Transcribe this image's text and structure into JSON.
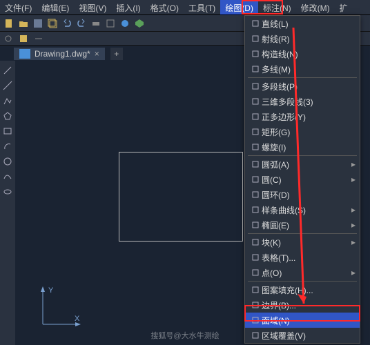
{
  "menubar": {
    "items": [
      "文件(F)",
      "编辑(E)",
      "视图(V)",
      "插入(I)",
      "格式(O)",
      "工具(T)",
      "绘图(D)",
      "标注(N)",
      "修改(M)",
      "扩"
    ],
    "activeIndex": 6
  },
  "tab": {
    "label": "Drawing1.dwg*"
  },
  "dropdown": {
    "items": [
      {
        "icon": "line-icon",
        "label": "直线(L)",
        "sub": false
      },
      {
        "icon": "ray-icon",
        "label": "射线(R)",
        "sub": false
      },
      {
        "icon": "xline-icon",
        "label": "构造线(N)",
        "sub": false
      },
      {
        "icon": "mline-icon",
        "label": "多线(M)",
        "sub": false
      },
      {
        "sep": true
      },
      {
        "icon": "pline-icon",
        "label": "多段线(P)",
        "sub": false
      },
      {
        "icon": "3dpoly-icon",
        "label": "三维多段线(3)",
        "sub": false
      },
      {
        "icon": "polygon-icon",
        "label": "正多边形(Y)",
        "sub": false
      },
      {
        "icon": "rectangle-icon",
        "label": "矩形(G)",
        "sub": false
      },
      {
        "icon": "helix-icon",
        "label": "螺旋(I)",
        "sub": false
      },
      {
        "sep": true
      },
      {
        "icon": "arc-icon",
        "label": "圆弧(A)",
        "sub": true
      },
      {
        "icon": "circle-icon",
        "label": "圆(C)",
        "sub": true
      },
      {
        "icon": "donut-icon",
        "label": "圆环(D)",
        "sub": false
      },
      {
        "icon": "spline-icon",
        "label": "样条曲线(S)",
        "sub": true
      },
      {
        "icon": "ellipse-icon",
        "label": "椭圆(E)",
        "sub": true
      },
      {
        "sep": true
      },
      {
        "icon": "block-icon",
        "label": "块(K)",
        "sub": true
      },
      {
        "icon": "table-icon",
        "label": "表格(T)...",
        "sub": false
      },
      {
        "icon": "point-icon",
        "label": "点(O)",
        "sub": true
      },
      {
        "sep": true
      },
      {
        "icon": "hatch-icon",
        "label": "图案填充(H)...",
        "sub": false
      },
      {
        "icon": "boundary-icon",
        "label": "边界(B)...",
        "sub": false
      },
      {
        "icon": "region-icon",
        "label": "面域(N)",
        "sub": false,
        "highlight": true
      },
      {
        "icon": "wipeout-icon",
        "label": "区域覆盖(V)",
        "sub": false
      }
    ]
  },
  "ucs": {
    "y": "Y",
    "x": "X"
  },
  "watermark": "搜狐号@大水牛测绘"
}
